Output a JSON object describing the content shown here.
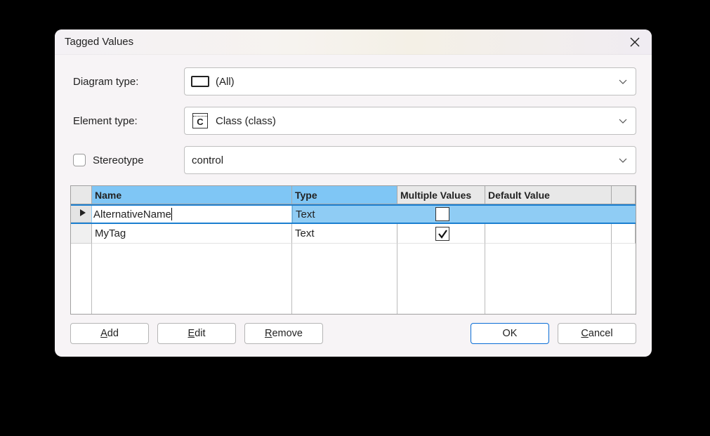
{
  "title": "Tagged Values",
  "labels": {
    "diagram_type": "Diagram type:",
    "element_type": "Element type:",
    "stereotype": "Stereotype"
  },
  "dropdowns": {
    "diagram_value": "(All)",
    "element_value": "Class (class)",
    "stereotype_value": "control"
  },
  "table": {
    "headers": {
      "name": "Name",
      "type": "Type",
      "multiple": "Multiple Values",
      "default": "Default Value"
    },
    "rows": [
      {
        "name": "AlternativeName",
        "type": "Text",
        "multiple": false,
        "default": "",
        "editing": true
      },
      {
        "name": "MyTag",
        "type": "Text",
        "multiple": true,
        "default": "",
        "editing": false
      }
    ]
  },
  "buttons": {
    "add_u": "A",
    "add_rest": "dd",
    "edit_u": "E",
    "edit_rest": "dit",
    "remove_u": "R",
    "remove_rest": "emove",
    "ok": "OK",
    "cancel_u": "C",
    "cancel_rest": "ancel"
  }
}
